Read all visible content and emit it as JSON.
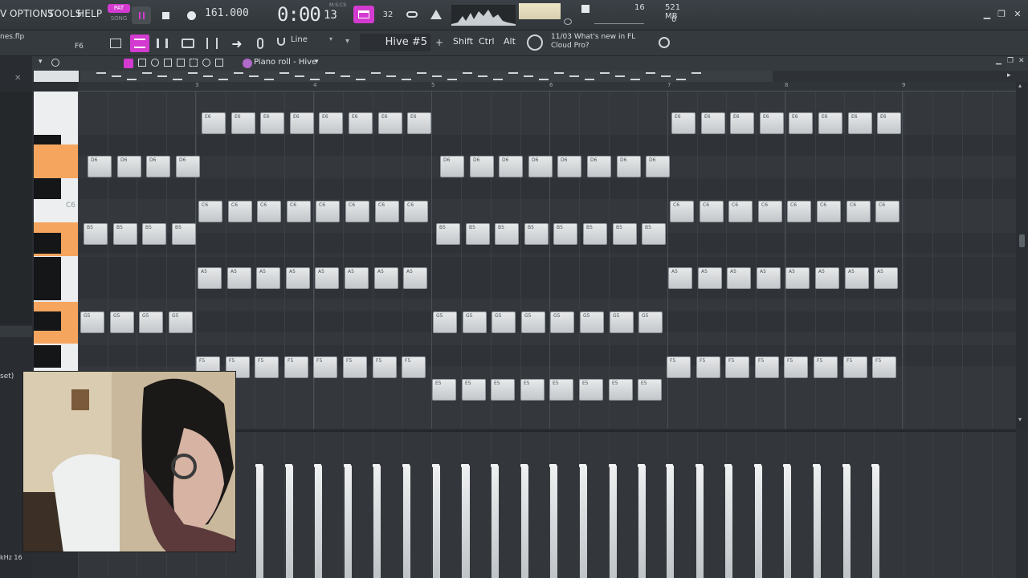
{
  "menu": {
    "items": [
      "VIEW",
      "OPTIONS",
      "TOOLS",
      "HELP"
    ],
    "visible_items": [
      "V",
      "OPTIONS",
      "TOOLS",
      "HELP"
    ]
  },
  "transport": {
    "pat_label": "PAT",
    "song_label": "SONG",
    "tempo": "161.000",
    "time_main": "0:00",
    "time_small": "13",
    "time_unit": "M:S:CS",
    "step_label": "32",
    "accent_color": "#d33bd0"
  },
  "sysinfo": {
    "memory": "521 MB",
    "polyphony": "0",
    "cpu_value": "16"
  },
  "toolbar2": {
    "file_name": "nes.flp",
    "shortcut": "F6",
    "snap_mode": "Line",
    "instrument": "Hive #5",
    "keys": [
      "Shift",
      "Ctrl",
      "Alt"
    ],
    "news_date": "11/03",
    "news_text": "What's new in FL Cloud Pro?"
  },
  "piano_roll": {
    "title": "Piano roll - Hive",
    "c6_label": "C6",
    "bar_numbers": [
      "3",
      "4",
      "5",
      "6",
      "7",
      "8",
      "9"
    ],
    "note_color": "#d8dbdd",
    "highlight_color": "#f6a55e"
  },
  "left_panel": {
    "preset_label": "set)",
    "sample_rate_label": "kHz 16"
  }
}
